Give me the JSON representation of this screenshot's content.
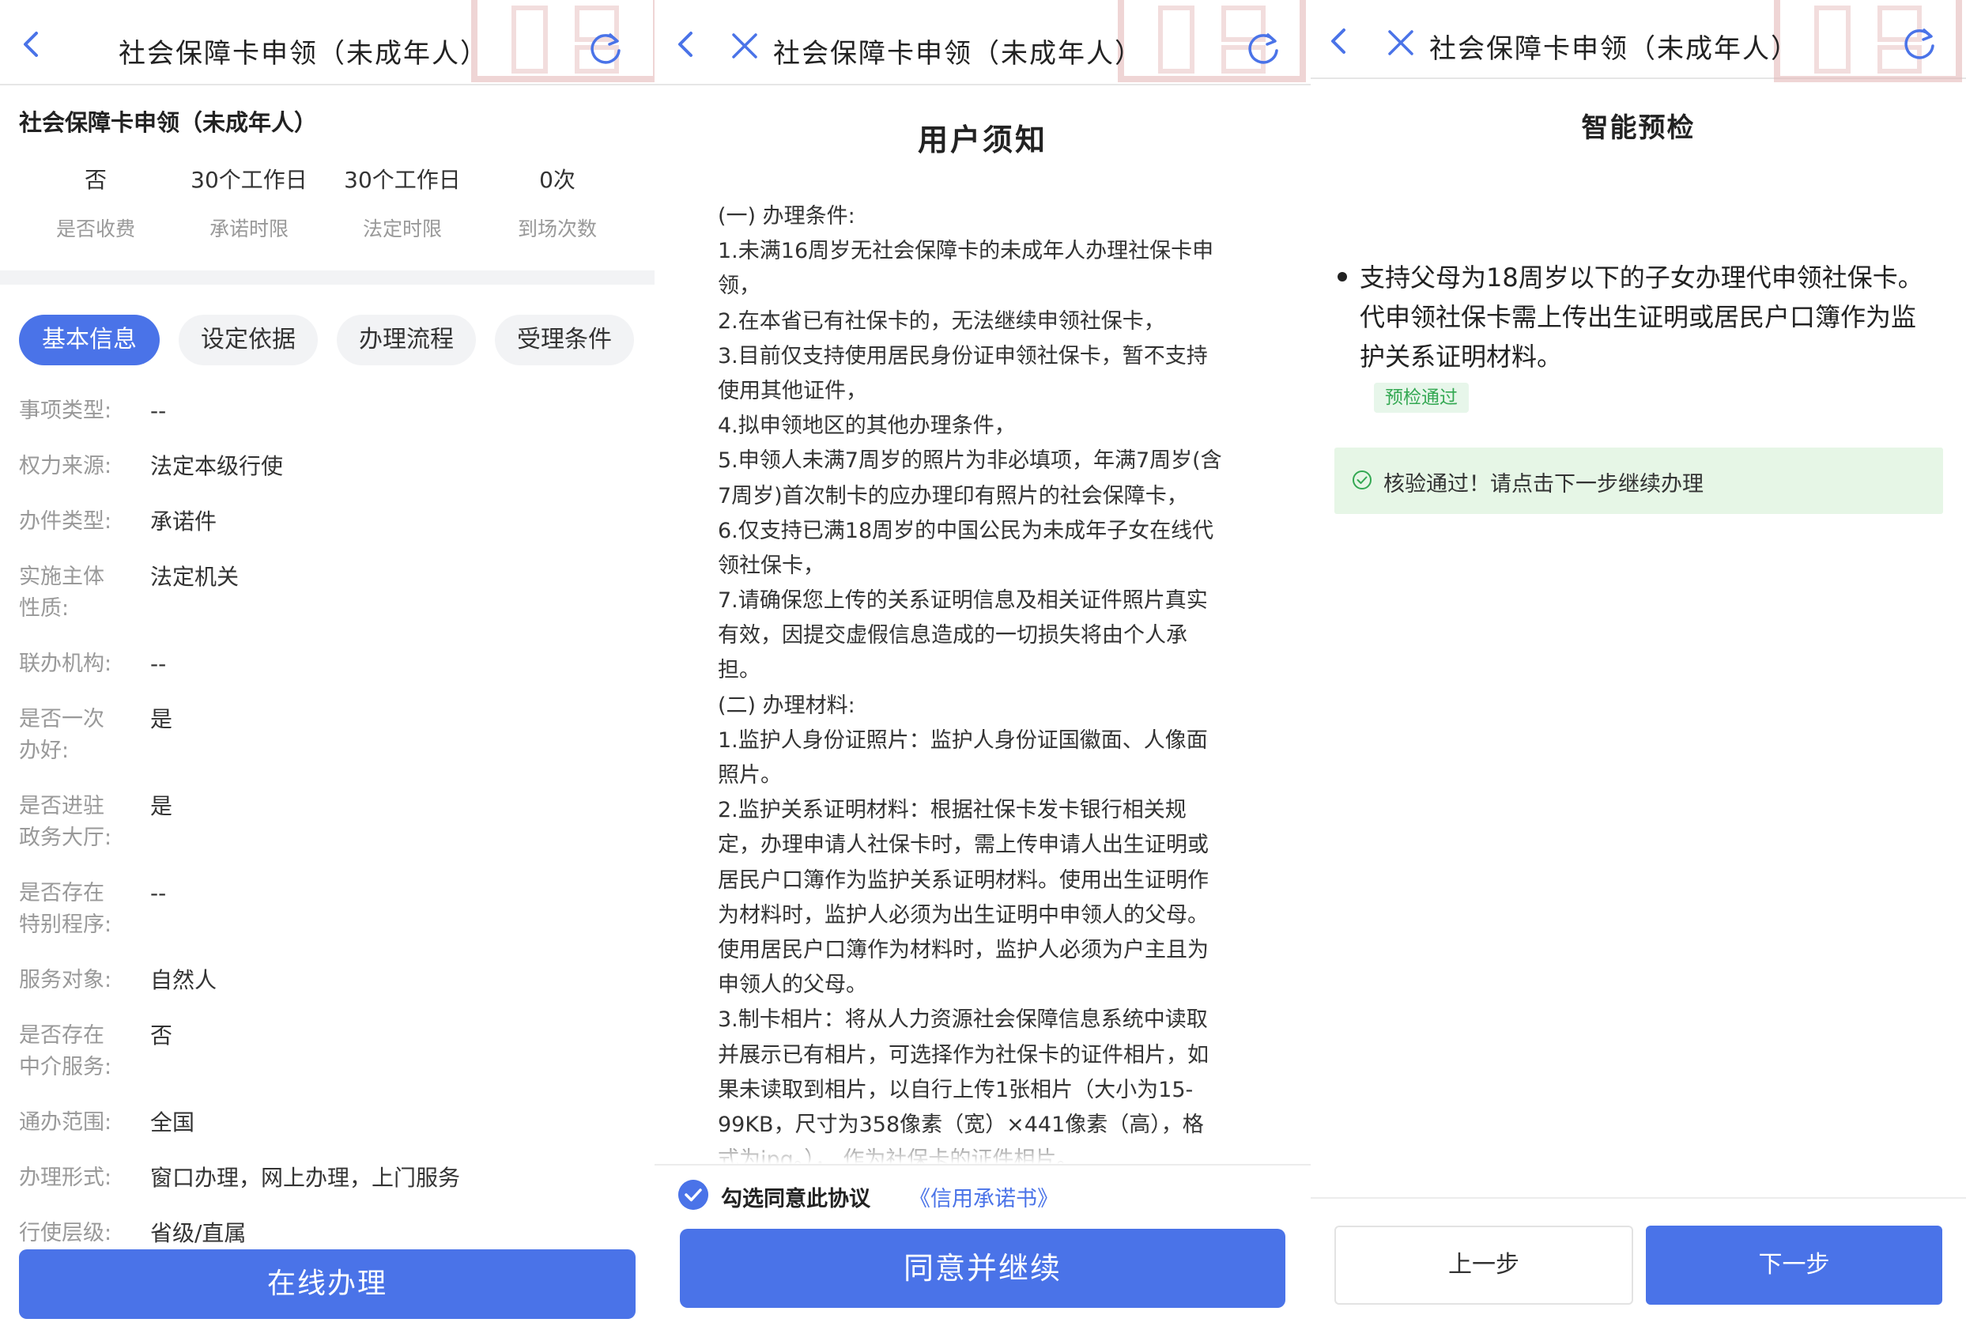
{
  "header": {
    "title": "社会保障卡申领（未成年人）"
  },
  "panel1": {
    "subtitle": "社会保障卡申领（未成年人）",
    "stats": [
      {
        "value": "否",
        "label": "是否收费"
      },
      {
        "value": "30个工作日",
        "label": "承诺时限"
      },
      {
        "value": "30个工作日",
        "label": "法定时限"
      },
      {
        "value": "0次",
        "label": "到场次数"
      }
    ],
    "tabs": [
      "基本信息",
      "设定依据",
      "办理流程",
      "受理条件"
    ],
    "rows": [
      {
        "key": [
          "事项类型:"
        ],
        "value": "--"
      },
      {
        "key": [
          "权力来源:"
        ],
        "value": "法定本级行使"
      },
      {
        "key": [
          "办件类型:"
        ],
        "value": "承诺件"
      },
      {
        "key": [
          "实施主体",
          "性质:"
        ],
        "value": "法定机关"
      },
      {
        "key": [
          "联办机构:"
        ],
        "value": "--"
      },
      {
        "key": [
          "是否一次",
          "办好:"
        ],
        "value": "是"
      },
      {
        "key": [
          "是否进驻",
          "政务大厅:"
        ],
        "value": "是"
      },
      {
        "key": [
          "是否存在",
          "特别程序:"
        ],
        "value": "--"
      },
      {
        "key": [
          "服务对象:"
        ],
        "value": "自然人"
      },
      {
        "key": [
          "是否存在",
          "中介服务:"
        ],
        "value": "否"
      },
      {
        "key": [
          "通办范围:"
        ],
        "value": "全国"
      },
      {
        "key": [
          "办理形式:"
        ],
        "value": "窗口办理，网上办理，上门服务"
      },
      {
        "key": [
          "行使层级:"
        ],
        "value": "省级/直属"
      }
    ],
    "action_button": "在线办理"
  },
  "panel2": {
    "title": "用户须知",
    "notice_lines": [
      "(一) 办理条件:",
      "1.未满16周岁无社会保障卡的未成年人办理社保卡申",
      "领，",
      "2.在本省已有社保卡的，无法继续申领社保卡，",
      "3.目前仅支持使用居民身份证申领社保卡，暂不支持",
      "使用其他证件，",
      "4.拟申领地区的其他办理条件，",
      "5.申领人未满7周岁的照片为非必填项，年满7周岁(含",
      "7周岁)首次制卡的应办理印有照片的社会保障卡，",
      "6.仅支持已满18周岁的中国公民为未成年子女在线代",
      "领社保卡，",
      "7.请确保您上传的关系证明信息及相关证件照片真实",
      "有效，因提交虚假信息造成的一切损失将由个人承",
      "担。",
      "(二) 办理材料:",
      "1.监护人身份证照片：监护人身份证国徽面、人像面",
      "照片。",
      "2.监护关系证明材料：根据社保卡发卡银行相关规",
      "定，办理申请人社保卡时，需上传申请人出生证明或",
      "居民户口簿作为监护关系证明材料。使用出生证明作",
      "为材料时，监护人必须为出生证明中申领人的父母。",
      "使用居民户口簿作为材料时，监护人必须为户主且为",
      "申领人的父母。",
      "3.制卡相片：将从人力资源社会保障信息系统中读取",
      "并展示已有相片，可选择作为社保卡的证件相片，如",
      "果未读取到相片，以自行上传1张相片（大小为15-",
      "99KB，尺寸为358像素（宽）×441像素（高），格",
      "式为jpg。）， 作为社保卡的证件相片。"
    ],
    "agree_text": "勾选同意此协议",
    "agree_link": "《信用承诺书》",
    "action_button": "同意并继续"
  },
  "panel3": {
    "title": "智能预检",
    "bullet_lines": [
      "支持父母为18周岁以下的子女办理代申领社保卡。",
      "代申领社保卡需上传出生证明或居民户口簿作为监",
      "护关系证明材料。"
    ],
    "pass_tag": "预检通过",
    "ok_message": "核验通过！请点击下一步继续办理",
    "prev_button": "上一步",
    "next_button": "下一步"
  },
  "colors": {
    "accent": "#4a73e8",
    "success_bg": "#e6f6e6",
    "success_fg": "#33a852",
    "muted": "#999999"
  }
}
